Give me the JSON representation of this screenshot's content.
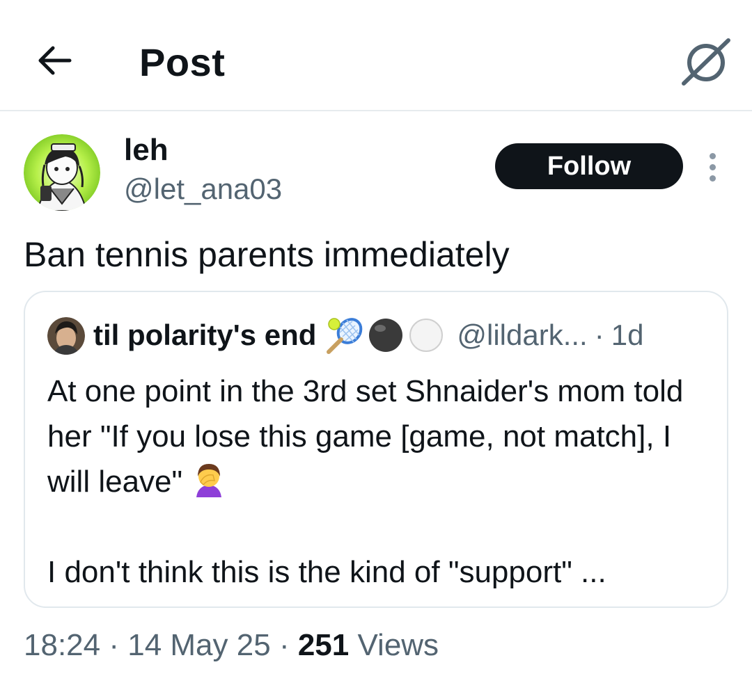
{
  "header": {
    "title": "Post",
    "back_icon": "arrow-left-icon",
    "grok_icon": "grok-icon"
  },
  "author": {
    "display_name": "leh",
    "handle": "@let_ana03",
    "follow_label": "Follow",
    "more_icon": "more-vertical-icon"
  },
  "post": {
    "text": "Ban tennis parents immediately"
  },
  "quote": {
    "display_name": "til polarity's end",
    "name_emojis": [
      "tennis-racket-icon",
      "black-circle-icon",
      "white-circle-icon"
    ],
    "handle": "@lildark...",
    "separator": "·",
    "time": "1d",
    "body_line1": "At one point in the 3rd set Shnaider's mom told her \"If you lose this game [game, not match], I will leave\"",
    "body_emoji": "woman-facepalming-icon",
    "body_line2": "I don't think this is the kind of \"support\" ..."
  },
  "meta": {
    "time": "18:24",
    "sep1": "·",
    "date": "14 May 25",
    "sep2": "·",
    "views_count": "251",
    "views_label": "Views"
  },
  "colors": {
    "text_primary": "#0f1419",
    "text_secondary": "#536471",
    "divider": "#e6ebee",
    "follow_bg": "#0f1419"
  }
}
